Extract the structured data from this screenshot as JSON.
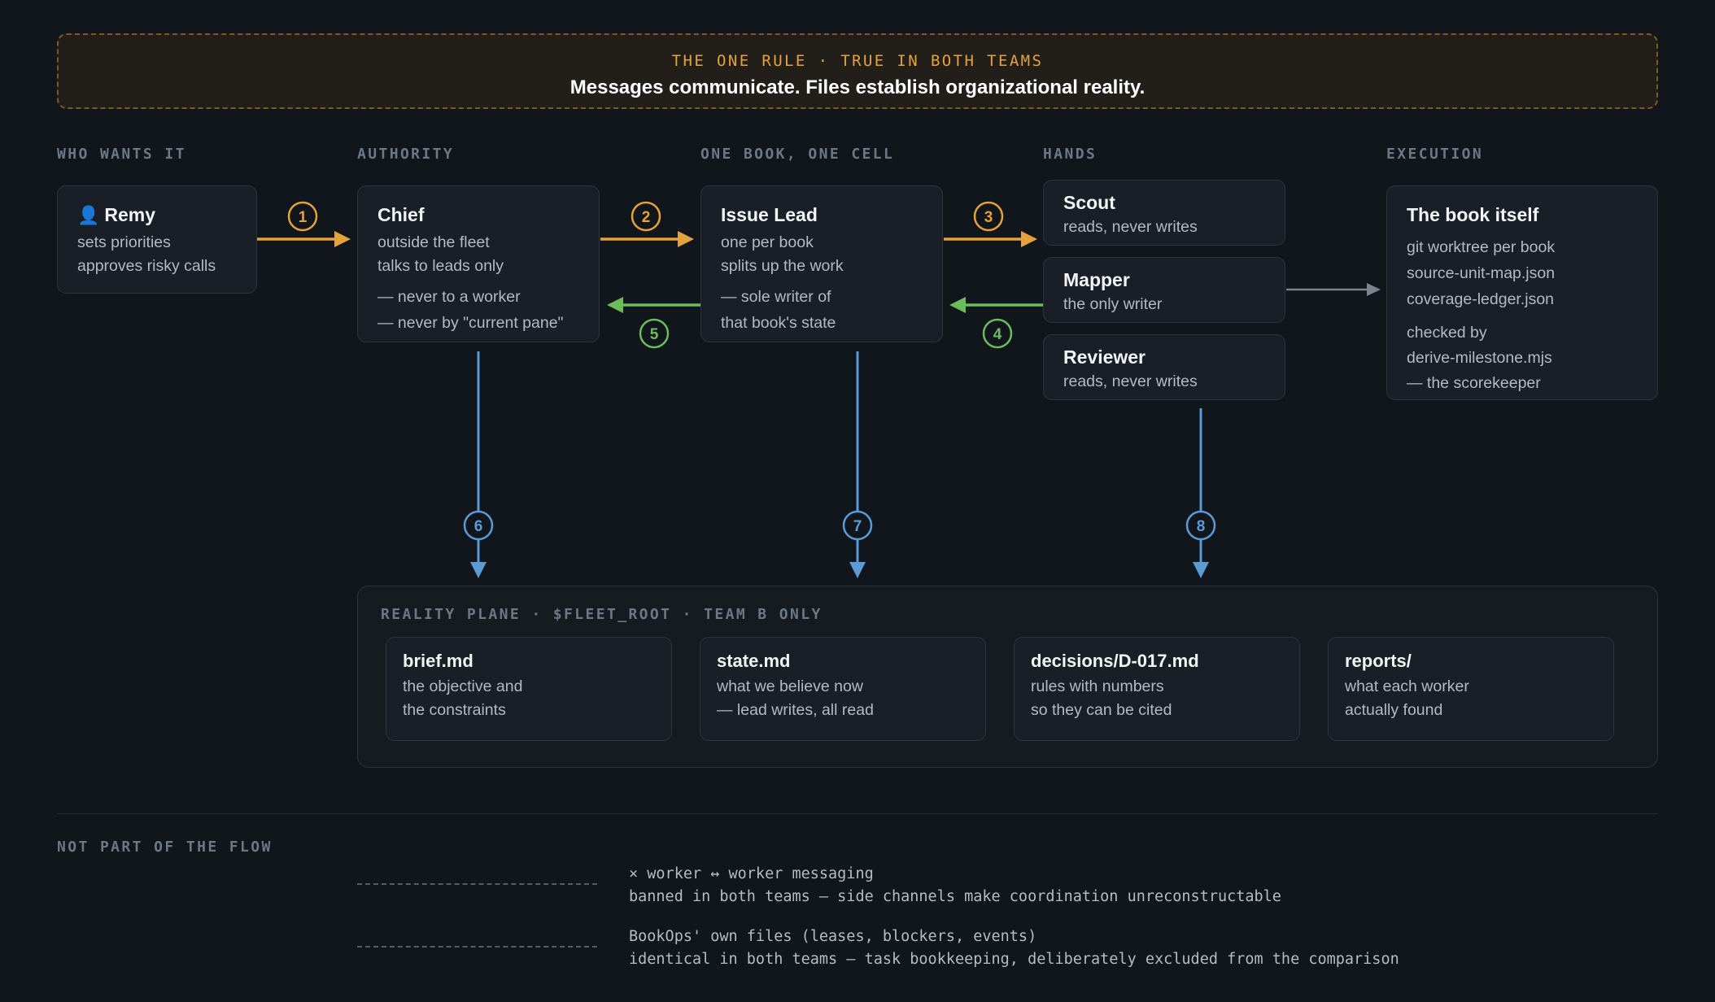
{
  "banner": {
    "kicker": "THE ONE RULE · TRUE IN BOTH TEAMS",
    "title": "Messages communicate. Files establish organizational reality."
  },
  "columns": {
    "who": "WHO WANTS IT",
    "authority": "AUTHORITY",
    "book": "ONE BOOK, ONE CELL",
    "hands": "HANDS",
    "execution": "EXECUTION"
  },
  "remy": {
    "icon": "person-icon",
    "title": "Remy",
    "lines": [
      "sets priorities",
      "approves risky calls"
    ]
  },
  "chief": {
    "title": "Chief",
    "lines": [
      "outside the fleet",
      "talks to leads only"
    ],
    "notes": [
      "— never to a worker",
      "— never by \"current pane\""
    ]
  },
  "issue_lead": {
    "title": "Issue Lead",
    "lines": [
      "one per book",
      "splits up the work"
    ],
    "notes": [
      "— sole writer of",
      "that book's state"
    ]
  },
  "hands": {
    "scout": {
      "title": "Scout",
      "line": "reads, never writes"
    },
    "mapper": {
      "title": "Mapper",
      "line": "the only writer"
    },
    "reviewer": {
      "title": "Reviewer",
      "line": "reads, never writes"
    }
  },
  "book": {
    "title": "The book itself",
    "lines": [
      "git worktree per book",
      "source-unit-map.json",
      "coverage-ledger.json"
    ],
    "notes": [
      "checked by",
      "derive-milestone.mjs",
      "— the scorekeeper"
    ]
  },
  "steps": [
    "1",
    "2",
    "3",
    "4",
    "5",
    "6",
    "7",
    "8"
  ],
  "colors": {
    "orange": "#e4a23c",
    "green": "#6bbd5c",
    "blue": "#5b9bd5",
    "gray": "#7b828c"
  },
  "plane": {
    "heading": "REALITY PLANE · $FLEET_ROOT · TEAM B ONLY",
    "files": [
      {
        "title": "brief.md",
        "lines": [
          "the objective and",
          "the constraints"
        ]
      },
      {
        "title": "state.md",
        "lines": [
          "what we believe now",
          "— lead writes, all read"
        ]
      },
      {
        "title": "decisions/D-017.md",
        "lines": [
          "rules with numbers",
          "so they can be cited"
        ]
      },
      {
        "title": "reports/",
        "lines": [
          "what each worker",
          "actually found"
        ]
      }
    ]
  },
  "not_part": {
    "heading": "NOT PART OF THE FLOW",
    "items": [
      {
        "line1": "× worker ↔ worker messaging",
        "line2": "banned in both teams — side channels make coordination unreconstructable"
      },
      {
        "line1": "BookOps' own files (leases, blockers, events)",
        "line2": "identical in both teams — task bookkeeping, deliberately excluded from the comparison"
      }
    ]
  }
}
